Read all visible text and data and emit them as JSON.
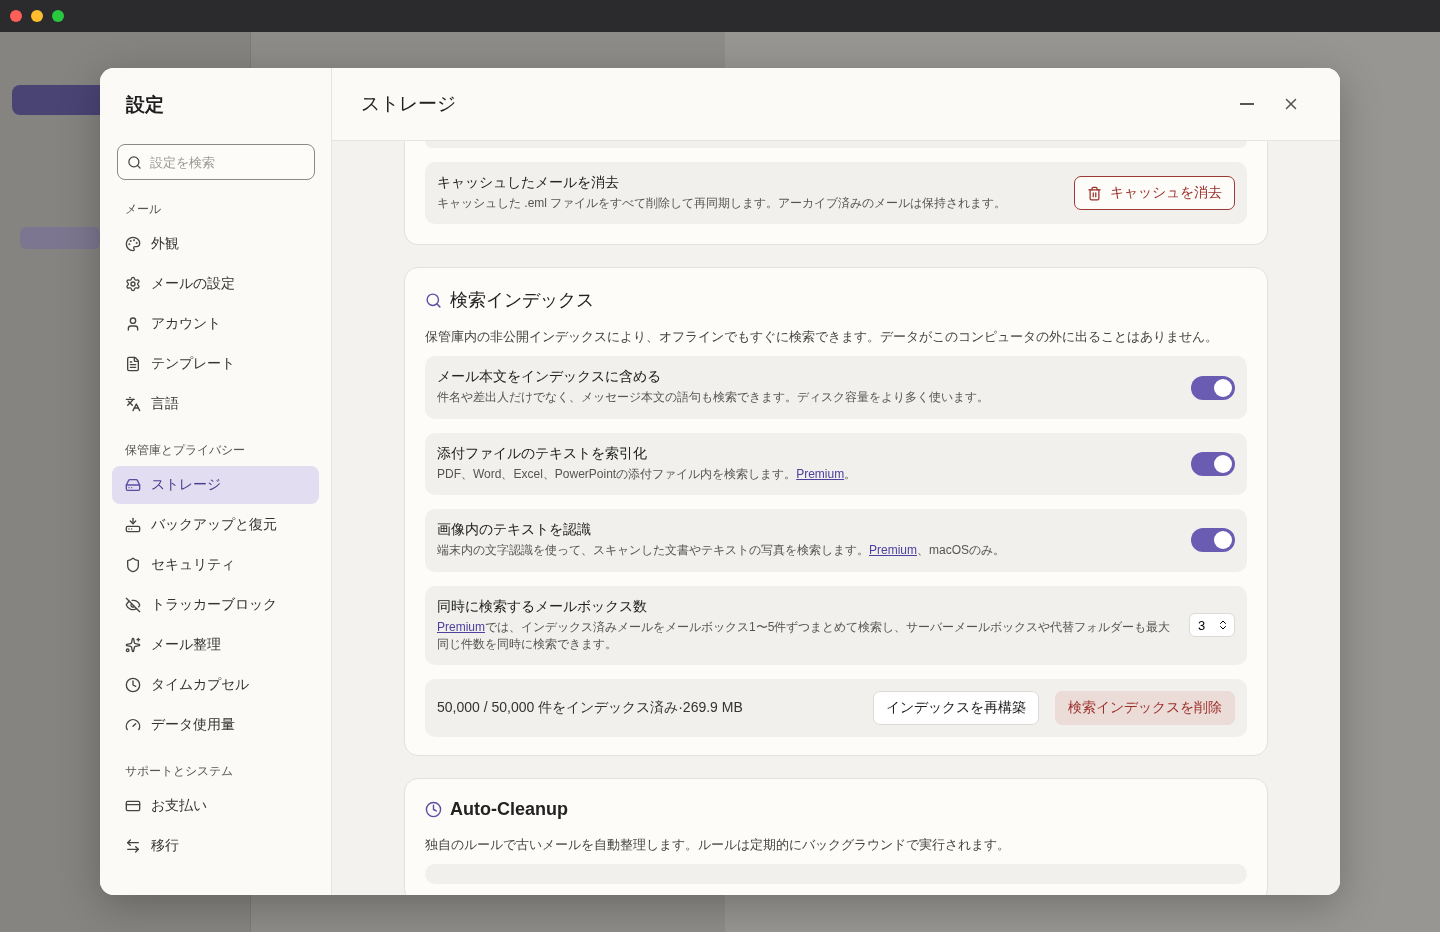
{
  "settings": {
    "title": "設定",
    "search": {
      "placeholder": "設定を検索"
    },
    "sections": [
      {
        "heading": "メール",
        "items": [
          {
            "label": "外観",
            "selected": false
          },
          {
            "label": "メールの設定",
            "selected": false
          },
          {
            "label": "アカウント",
            "selected": false
          },
          {
            "label": "テンプレート",
            "selected": false
          },
          {
            "label": "言語",
            "selected": false
          }
        ]
      },
      {
        "heading": "保管庫とプライバシー",
        "items": [
          {
            "label": "ストレージ",
            "selected": true
          },
          {
            "label": "バックアップと復元",
            "selected": false
          },
          {
            "label": "セキュリティ",
            "selected": false
          },
          {
            "label": "トラッカーブロック",
            "selected": false
          },
          {
            "label": "メール整理",
            "selected": false
          },
          {
            "label": "タイムカプセル",
            "selected": false
          },
          {
            "label": "データ使用量",
            "selected": false
          }
        ]
      },
      {
        "heading": "サポートとシステム",
        "items": [
          {
            "label": "お支払い",
            "selected": false
          },
          {
            "label": "移行",
            "selected": false
          }
        ]
      }
    ]
  },
  "page": {
    "title": "ストレージ"
  },
  "cards": [
    {
      "rows": [
        {
          "kind": "action",
          "title": "キャッシュしたメールを消去",
          "description": [
            {
              "text": "キャッシュした .eml ファイルをすべて削除して再同期します。アーカイブ済みのメールは保持されます。"
            }
          ],
          "button": "キャッシュを消去"
        }
      ]
    },
    {
      "title": "検索インデックス",
      "description": "保管庫内の非公開インデックスにより、オフラインでもすぐに検索できます。データがこのコンピュータの外に出ることはありません。",
      "rows": [
        {
          "kind": "toggle",
          "title": "メール本文をインデックスに含める",
          "description": [
            {
              "text": "件名や差出人だけでなく、メッセージ本文の語句も検索できます。ディスク容量をより多く使います。"
            }
          ],
          "on": true
        },
        {
          "kind": "toggle",
          "title": "添付ファイルのテキストを索引化",
          "description": [
            {
              "text": "PDF、Word、Excel、PowerPointの添付ファイル内を検索します。"
            },
            {
              "link": "Premium"
            },
            {
              "text": "。"
            }
          ],
          "on": true
        },
        {
          "kind": "toggle",
          "title": "画像内のテキストを認識",
          "description": [
            {
              "text": "端末内の文字認識を使って、スキャンした文書やテキストの写真を検索します。"
            },
            {
              "link": "Premium"
            },
            {
              "text": "、macOSのみ。"
            }
          ],
          "on": true
        },
        {
          "kind": "stepper",
          "title": "同時に検索するメールボックス数",
          "description": [
            {
              "link": "Premium"
            },
            {
              "text": "では、インデックス済みメールをメールボックス1〜5件ずつまとめて検索し、サーバーメールボックスや代替フォルダーも最大同じ件数を同時に検索できます。"
            }
          ],
          "value": "3"
        },
        {
          "kind": "status",
          "text": "50,000 / 50,000 件をインデックス済み·269.9 MB",
          "buttons": [
            {
              "label": "インデックスを再構築",
              "kind": "secondary"
            },
            {
              "label": "検索インデックスを削除",
              "kind": "danger"
            }
          ]
        }
      ]
    },
    {
      "title": "Auto-Cleanup",
      "description": "独自のルールで古いメールを自動整理します。ルールは定期的にバックグラウンドで実行されます。",
      "rows": [
        {
          "kind": "stub"
        }
      ]
    }
  ]
}
